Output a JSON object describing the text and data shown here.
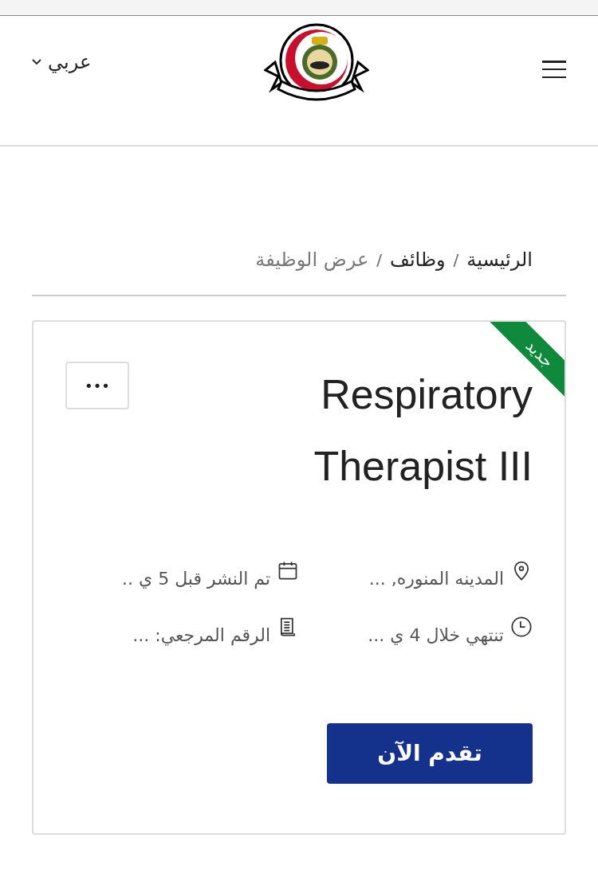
{
  "header": {
    "language": "عربي"
  },
  "breadcrumb": [
    {
      "label": "الرئيسية",
      "current": false
    },
    {
      "label": "وظائف",
      "current": false
    },
    {
      "label": "عرض الوظيفة",
      "current": true
    }
  ],
  "separator": "/",
  "job": {
    "badge": "جديد",
    "title": "Respiratory Therapist III",
    "more": "•••",
    "meta": [
      {
        "kind": "location",
        "text": "المدينه المنوره, ..."
      },
      {
        "kind": "posted",
        "text": "تم النشر قبل 5 ي .."
      },
      {
        "kind": "deadline",
        "text": "تنتهي خلال 4 ي ..."
      },
      {
        "kind": "reference",
        "text": "الرقم المرجعي: ..."
      }
    ],
    "apply": "تقدم الآن"
  }
}
